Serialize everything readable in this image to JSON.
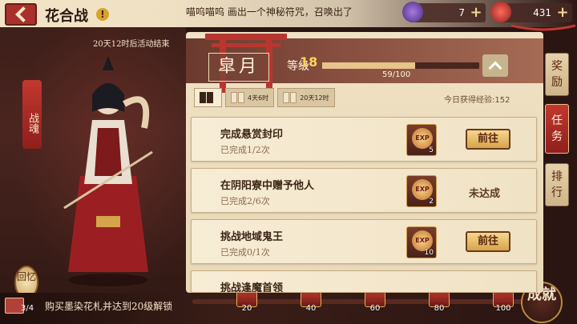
{
  "header": {
    "title": "花合战",
    "marquee": "喵呜喵呜 画出一个神秘符咒，召唤出了",
    "currencies": [
      {
        "icon": "magatama-icon",
        "value": "7",
        "color": "#7c4bb8"
      },
      {
        "icon": "jade-icon",
        "value": "431",
        "color": "#c2382e"
      }
    ]
  },
  "left": {
    "event_timer": "20天12时后活动结束",
    "side_tag": "战魂",
    "recall_label": "回忆",
    "book_count": "3/4",
    "unlock_text": "购买墨染花札并达到20级解锁"
  },
  "rank": {
    "name": "皐月",
    "level_label": "等级",
    "level_value": "18",
    "exp_current": 59,
    "exp_max": 100,
    "exp_text": "59/100"
  },
  "periods": [
    {
      "text": "",
      "active": true
    },
    {
      "text": "4天6时",
      "active": false
    },
    {
      "text": "20天12时",
      "active": false
    }
  ],
  "today_exp": "今日获得经验:152",
  "tasks": [
    {
      "name": "完成悬赏封印",
      "progress": "已完成1/2次",
      "reward_qty": "5",
      "action": "前往",
      "status": "go"
    },
    {
      "name": "在阴阳寮中赠予他人",
      "progress": "已完成2/6次",
      "reward_qty": "2",
      "action": "未达成",
      "status": "locked"
    },
    {
      "name": "挑战地域鬼王",
      "progress": "已完成0/1次",
      "reward_qty": "10",
      "action": "前往",
      "status": "go"
    },
    {
      "name": "挑战逢魔首领",
      "progress": "",
      "reward_qty": "",
      "action": "",
      "status": "go"
    }
  ],
  "reward_icon_label": "EXP",
  "side_tabs": [
    {
      "label": "奖励",
      "active": false
    },
    {
      "label": "任务",
      "active": true
    },
    {
      "label": "排行",
      "active": false
    }
  ],
  "milestones": [
    "20",
    "40",
    "60",
    "80",
    "100"
  ],
  "milestone_progress": 0.0,
  "achievement_label": "成就"
}
